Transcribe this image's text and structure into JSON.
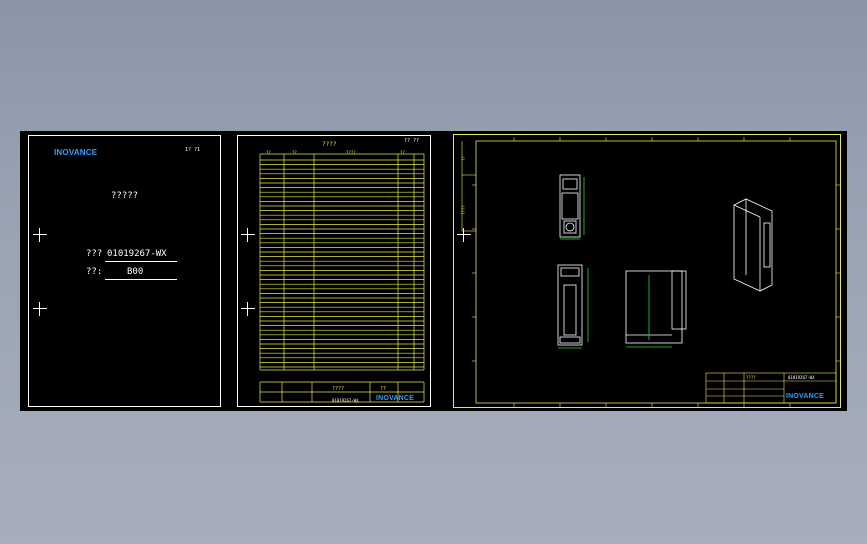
{
  "cover": {
    "logo": "INOVANCE",
    "page_mark": "1?  ?1",
    "title": "?????",
    "code_label": "???",
    "code_value": "01019267-WX",
    "version_label": "??:",
    "version_value": "B00"
  },
  "record": {
    "header_title": "????",
    "page_mark": "?? ??",
    "col_headers": [
      "??",
      "??",
      "????",
      "??"
    ],
    "doc_number": "01019267-WX",
    "logo": "INOVANCE",
    "footer_labels": [
      "??",
      "??",
      "??",
      "??"
    ],
    "footer_mid": "????",
    "footer_right": "??"
  },
  "drawing": {
    "side_labels": [
      "??",
      "????"
    ],
    "tb_title": "????",
    "tb_doc": "01019267-WX",
    "logo": "INOVANCE",
    "tb_labels": [
      "??",
      "??",
      "??",
      "??"
    ]
  },
  "colors": {
    "background": "#000000",
    "frame": "#ffffff",
    "table": "#e8e84a",
    "dimension": "#22dd22",
    "brand": "#2aa1ff"
  }
}
